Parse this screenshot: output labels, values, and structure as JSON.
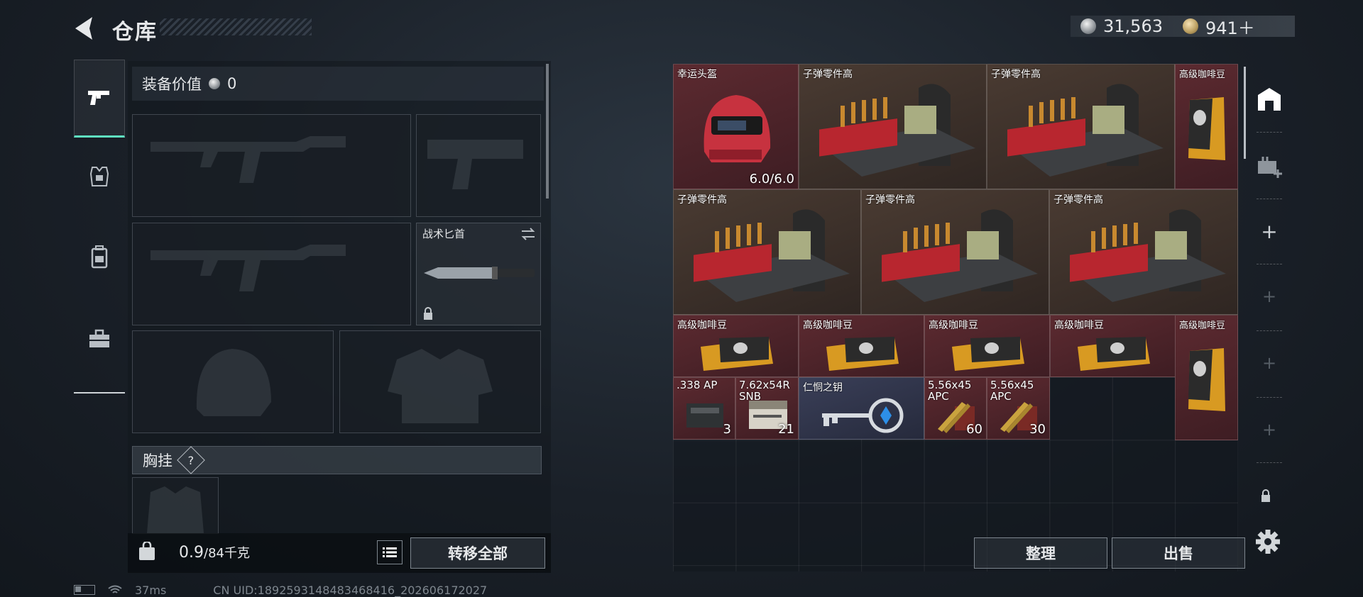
{
  "header": {
    "title": "仓库",
    "currency_silver": "31,563",
    "currency_gold": "941＋"
  },
  "left": {
    "equip_label": "装备价值",
    "equip_value": "0",
    "knife_label": "战术匕首",
    "chest_label": "胸挂",
    "chest_help": "?",
    "weight_value": "0.9",
    "weight_max": "/84千克",
    "transfer_all": "转移全部"
  },
  "items": [
    {
      "name": "幸运头盔",
      "count": "6.0/6.0"
    },
    {
      "name": "子弹零件高"
    },
    {
      "name": "子弹零件高"
    },
    {
      "name": "高级咖啡豆"
    },
    {
      "name": "子弹零件高"
    },
    {
      "name": "子弹零件高"
    },
    {
      "name": "子弹零件高"
    },
    {
      "name": "高级咖啡豆"
    },
    {
      "name": "高级咖啡豆"
    },
    {
      "name": "高级咖啡豆"
    },
    {
      "name": "高级咖啡豆"
    },
    {
      "name": "高级咖啡豆"
    },
    {
      "name": ".338 AP",
      "count": "3"
    },
    {
      "name": "7.62x54R SNB",
      "count": "21"
    },
    {
      "name": "仁恫之钥"
    },
    {
      "name": "5.56x45 APC",
      "count": "60"
    },
    {
      "name": "5.56x45 APC",
      "count": "30"
    }
  ],
  "right": {
    "sort": "整理",
    "sell": "出售"
  },
  "status": {
    "ping": "37ms",
    "uid": "CN UID:1892593148483468416_202606172027"
  },
  "colors": {
    "accent": "#5fe3c1",
    "rarity_red": "#5c2a30",
    "rarity_brown": "#4a3b32",
    "rarity_blue": "#3a3f58"
  },
  "icons": [
    "back-arrow-icon",
    "pistol-icon",
    "armor-vest-icon",
    "backpack-icon",
    "toolbox-icon",
    "lock-icon",
    "swap-icon",
    "list-icon",
    "weight-icon",
    "storage-icon",
    "medkit-add-icon",
    "plus-icon",
    "gear-icon",
    "battery-icon",
    "wifi-icon"
  ]
}
